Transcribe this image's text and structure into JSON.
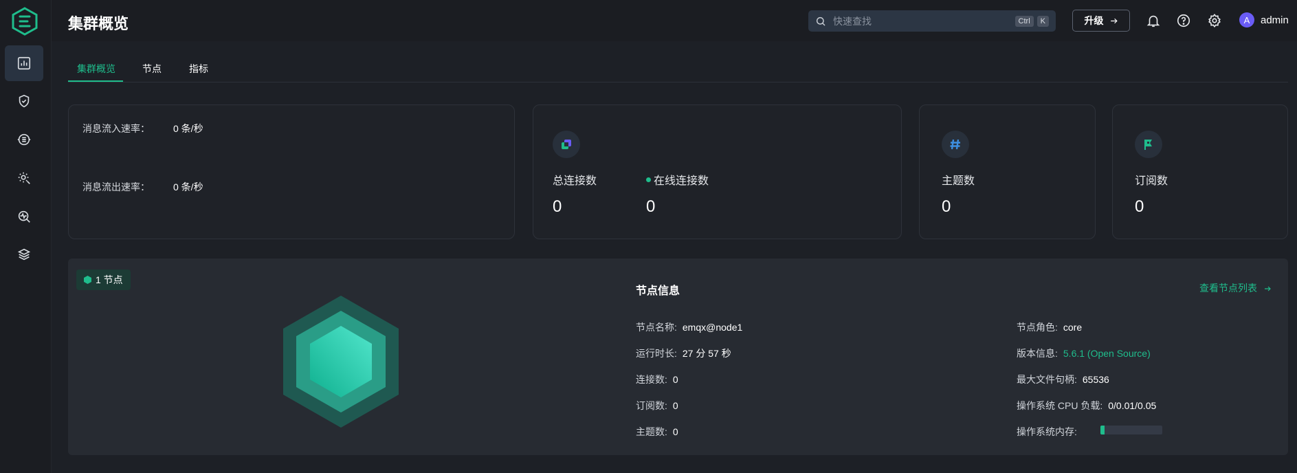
{
  "header": {
    "title": "集群概览",
    "search_placeholder": "快速查找",
    "shortcut_keys": [
      "Ctrl",
      "K"
    ],
    "upgrade_label": "升级",
    "user": {
      "avatar_letter": "A",
      "name": "admin"
    }
  },
  "sidebar": {
    "items": [
      {
        "icon": "dashboard-icon",
        "active": true
      },
      {
        "icon": "shield-check-icon",
        "active": false
      },
      {
        "icon": "data-integration-icon",
        "active": false
      },
      {
        "icon": "management-gear-icon",
        "active": false
      },
      {
        "icon": "diagnose-icon",
        "active": false
      },
      {
        "icon": "layers-icon",
        "active": false
      }
    ]
  },
  "tabs": [
    "集群概览",
    "节点",
    "指标"
  ],
  "rates": {
    "in_label": "消息流入速率：",
    "in_value": "0 条/秒",
    "out_label": "消息流出速率：",
    "out_value": "0 条/秒"
  },
  "stats": {
    "total_connections_label": "总连接数",
    "total_connections_value": "0",
    "online_connections_label": "在线连接数",
    "online_connections_value": "0",
    "topics_label": "主题数",
    "topics_value": "0",
    "subscriptions_label": "订阅数",
    "subscriptions_value": "0"
  },
  "nodes": {
    "badge": "1 节点",
    "info_title": "节点信息",
    "view_list_link": "查看节点列表",
    "left_fields": [
      {
        "label": "节点名称:",
        "value": "emqx@node1"
      },
      {
        "label": "运行时长:",
        "value": "27 分 57 秒"
      },
      {
        "label": "连接数:",
        "value": "0"
      },
      {
        "label": "订阅数:",
        "value": "0"
      },
      {
        "label": "主题数:",
        "value": "0"
      }
    ],
    "right_fields": [
      {
        "label": "节点角色:",
        "value": "core"
      },
      {
        "label": "版本信息:",
        "value": "5.6.1 (Open Source)"
      },
      {
        "label": "最大文件句柄:",
        "value": "65536"
      },
      {
        "label": "操作系统 CPU 负载:",
        "value": "0/0.01/0.05"
      },
      {
        "label": "操作系统内存:",
        "value": ""
      }
    ],
    "memory_usage_fraction": 0.07
  },
  "colors": {
    "accent": "#1fbd8c",
    "avatar": "#6a5cf6",
    "background": "#1d1f24"
  }
}
